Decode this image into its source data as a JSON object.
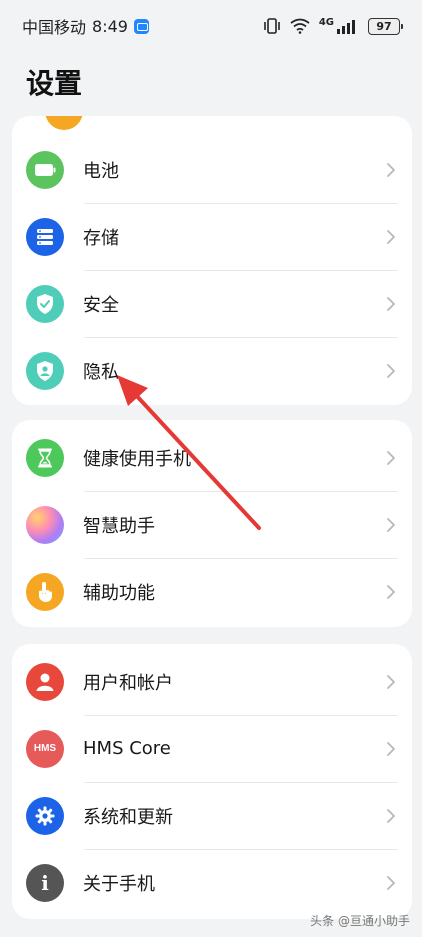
{
  "status_bar": {
    "carrier": "中国移动",
    "time": "8:49",
    "network_label": "4G",
    "battery": "97"
  },
  "page": {
    "title": "设置"
  },
  "groups": [
    {
      "items": [
        {
          "label": "电池",
          "icon": "battery-icon",
          "color": "#5cc45f"
        },
        {
          "label": "存储",
          "icon": "storage-icon",
          "color": "#1d63e8"
        },
        {
          "label": "安全",
          "icon": "shield-check-icon",
          "color": "#4ecdb9"
        },
        {
          "label": "隐私",
          "icon": "privacy-icon",
          "color": "#4ecdb9"
        }
      ]
    },
    {
      "items": [
        {
          "label": "健康使用手机",
          "icon": "hourglass-icon",
          "color": "#4cc95a"
        },
        {
          "label": "智慧助手",
          "icon": "smart-assistant-icon",
          "color": "#c98ff0"
        },
        {
          "label": "辅助功能",
          "icon": "hand-icon",
          "color": "#f5a623"
        }
      ]
    },
    {
      "items": [
        {
          "label": "用户和帐户",
          "icon": "user-icon",
          "color": "#e8483b"
        },
        {
          "label": "HMS Core",
          "icon": "hms-icon",
          "color": "#e65a5a",
          "icon_text": "HMS"
        },
        {
          "label": "系统和更新",
          "icon": "gear-icon",
          "color": "#1d63e8"
        },
        {
          "label": "关于手机",
          "icon": "info-icon",
          "color": "#555555",
          "icon_text": "i"
        }
      ]
    }
  ],
  "watermark": "头条 @亘通小助手",
  "colors": {
    "annotation_arrow": "#e53935",
    "background": "#f1f3f5"
  }
}
